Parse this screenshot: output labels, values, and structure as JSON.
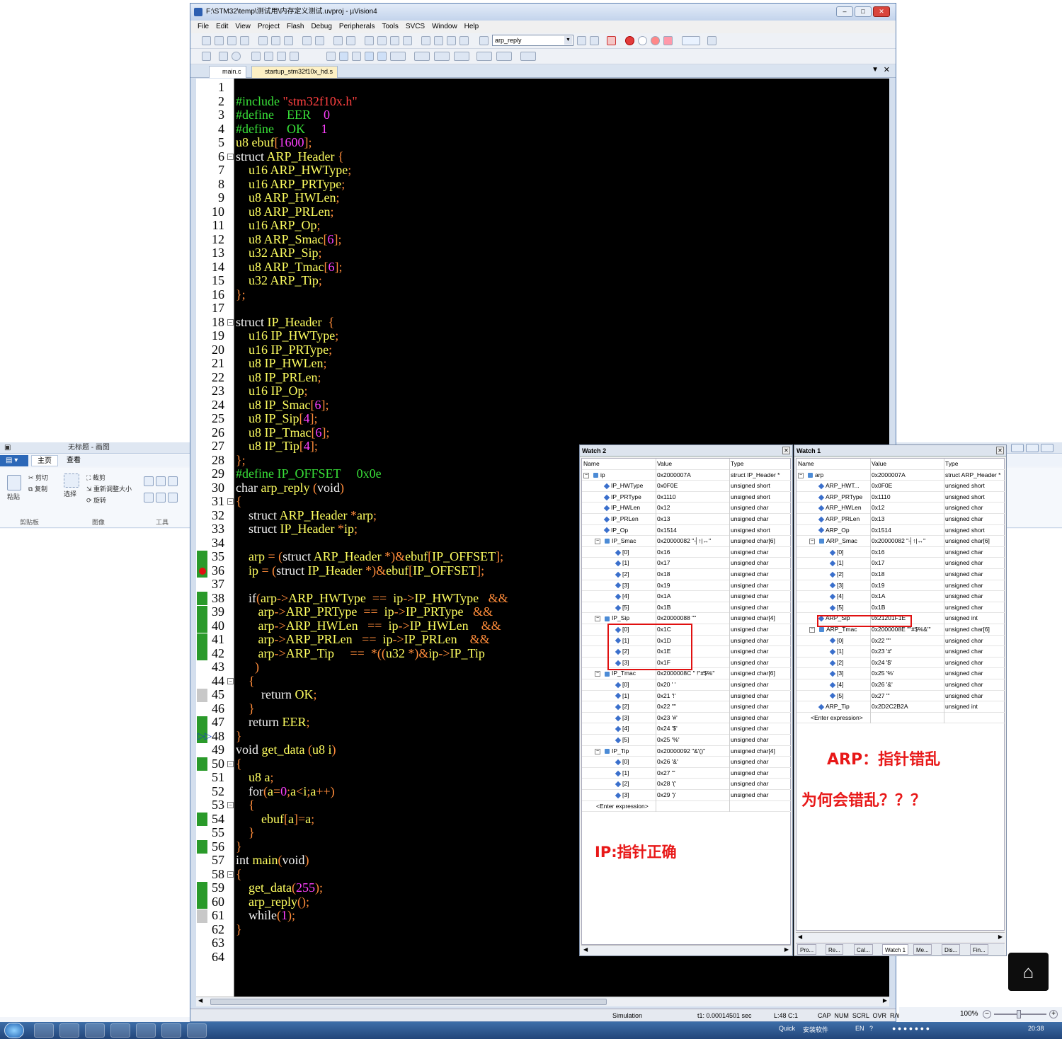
{
  "paint": {
    "title": "无标题 - 画图",
    "tabs": [
      "主页",
      "查看"
    ],
    "items": {
      "cut": "剪切",
      "copy": "复制",
      "paste": "粘贴",
      "crop": "裁剪",
      "resize": "重新调整大小",
      "rotate": "旋转",
      "select": "选择"
    },
    "groups": [
      "剪贴板",
      "图像",
      "工具"
    ],
    "zoom": "100%"
  },
  "uvision": {
    "title": "F:\\STM32\\temp\\测试用\\内存定义测试.uvproj - µVision4",
    "menu": [
      "File",
      "Edit",
      "View",
      "Project",
      "Flash",
      "Debug",
      "Peripherals",
      "Tools",
      "SVCS",
      "Window",
      "Help"
    ],
    "combo_value": "arp_reply",
    "tabs": [
      {
        "label": "main.c",
        "active": true
      },
      {
        "label": "startup_stm32f10x_hd.s",
        "active": false
      }
    ],
    "status": {
      "mode": "Simulation",
      "time": "t1: 0.00014501 sec",
      "pos": "L:48 C:1",
      "keys": "CAP  NUM  SCRL  OVR  R/W"
    }
  },
  "code_lines": [
    [],
    [
      [
        "pp",
        "#include "
      ],
      [
        "st",
        "\"stm32f10x.h\""
      ]
    ],
    [
      [
        "pp",
        "#define    EER    "
      ],
      [
        "nm",
        "0"
      ]
    ],
    [
      [
        "pp",
        "#define    OK     "
      ],
      [
        "nm",
        "1"
      ]
    ],
    [
      [
        "ty",
        "u8 ebuf"
      ],
      [
        "op",
        "["
      ],
      [
        "nm",
        "1600"
      ],
      [
        "op",
        "];"
      ]
    ],
    [
      [
        "wh",
        "struct "
      ],
      [
        "ty",
        "ARP_Header "
      ],
      [
        "op",
        "{"
      ]
    ],
    [
      [
        "ty",
        "    u16 ARP_HWType"
      ],
      [
        "op",
        ";"
      ]
    ],
    [
      [
        "ty",
        "    u16 ARP_PRType"
      ],
      [
        "op",
        ";"
      ]
    ],
    [
      [
        "ty",
        "    u8 ARP_HWLen"
      ],
      [
        "op",
        ";"
      ]
    ],
    [
      [
        "ty",
        "    u8 ARP_PRLen"
      ],
      [
        "op",
        ";"
      ]
    ],
    [
      [
        "ty",
        "    u16 ARP_Op"
      ],
      [
        "op",
        ";"
      ]
    ],
    [
      [
        "ty",
        "    u8 ARP_Smac"
      ],
      [
        "op",
        "["
      ],
      [
        "nm",
        "6"
      ],
      [
        "op",
        "];"
      ]
    ],
    [
      [
        "ty",
        "    u32 ARP_Sip"
      ],
      [
        "op",
        ";"
      ]
    ],
    [
      [
        "ty",
        "    u8 ARP_Tmac"
      ],
      [
        "op",
        "["
      ],
      [
        "nm",
        "6"
      ],
      [
        "op",
        "];"
      ]
    ],
    [
      [
        "ty",
        "    u32 ARP_Tip"
      ],
      [
        "op",
        ";"
      ]
    ],
    [
      [
        "op",
        "};"
      ]
    ],
    [],
    [
      [
        "wh",
        "struct "
      ],
      [
        "ty",
        "IP_Header  "
      ],
      [
        "op",
        "{"
      ]
    ],
    [
      [
        "ty",
        "    u16 IP_HWType"
      ],
      [
        "op",
        ";"
      ]
    ],
    [
      [
        "ty",
        "    u16 IP_PRType"
      ],
      [
        "op",
        ";"
      ]
    ],
    [
      [
        "ty",
        "    u8 IP_HWLen"
      ],
      [
        "op",
        ";"
      ]
    ],
    [
      [
        "ty",
        "    u8 IP_PRLen"
      ],
      [
        "op",
        ";"
      ]
    ],
    [
      [
        "ty",
        "    u16 IP_Op"
      ],
      [
        "op",
        ";"
      ]
    ],
    [
      [
        "ty",
        "    u8 IP_Smac"
      ],
      [
        "op",
        "["
      ],
      [
        "nm",
        "6"
      ],
      [
        "op",
        "];"
      ]
    ],
    [
      [
        "ty",
        "    u8 IP_Sip"
      ],
      [
        "op",
        "["
      ],
      [
        "nm",
        "4"
      ],
      [
        "op",
        "];"
      ]
    ],
    [
      [
        "ty",
        "    u8 IP_Tmac"
      ],
      [
        "op",
        "["
      ],
      [
        "nm",
        "6"
      ],
      [
        "op",
        "];"
      ]
    ],
    [
      [
        "ty",
        "    u8 IP_Tip"
      ],
      [
        "op",
        "["
      ],
      [
        "nm",
        "4"
      ],
      [
        "op",
        "];"
      ]
    ],
    [
      [
        "op",
        "};"
      ]
    ],
    [
      [
        "pp",
        "#define IP_OFFSET     0x0e"
      ]
    ],
    [
      [
        "wh",
        "char "
      ],
      [
        "ty",
        "arp_reply "
      ],
      [
        "op",
        "("
      ],
      [
        "wh",
        "void"
      ],
      [
        "op",
        ")"
      ]
    ],
    [
      [
        "op",
        "{"
      ]
    ],
    [
      [
        "wh",
        "    struct "
      ],
      [
        "ty",
        "ARP_Header "
      ],
      [
        "op",
        "*"
      ],
      [
        "ty",
        "arp"
      ],
      [
        "op",
        ";"
      ]
    ],
    [
      [
        "wh",
        "    struct "
      ],
      [
        "ty",
        "IP_Header "
      ],
      [
        "op",
        "*"
      ],
      [
        "ty",
        "ip"
      ],
      [
        "op",
        ";"
      ]
    ],
    [],
    [
      [
        "ty",
        "    arp "
      ],
      [
        "op",
        "= ("
      ],
      [
        "wh",
        "struct "
      ],
      [
        "ty",
        "ARP_Header "
      ],
      [
        "op",
        "*)&"
      ],
      [
        "ty",
        "ebuf"
      ],
      [
        "op",
        "["
      ],
      [
        "ty",
        "IP_OFFSET"
      ],
      [
        "op",
        "];"
      ]
    ],
    [
      [
        "ty",
        "    ip "
      ],
      [
        "op",
        "= ("
      ],
      [
        "wh",
        "struct "
      ],
      [
        "ty",
        "IP_Header "
      ],
      [
        "op",
        "*)&"
      ],
      [
        "ty",
        "ebuf"
      ],
      [
        "op",
        "["
      ],
      [
        "ty",
        "IP_OFFSET"
      ],
      [
        "op",
        "];"
      ]
    ],
    [],
    [
      [
        "wh",
        "    if"
      ],
      [
        "op",
        "("
      ],
      [
        "ty",
        "arp"
      ],
      [
        "op",
        "->"
      ],
      [
        "ty",
        "ARP_HWType  "
      ],
      [
        "op",
        "==  "
      ],
      [
        "ty",
        "ip"
      ],
      [
        "op",
        "->"
      ],
      [
        "ty",
        "IP_HWType   "
      ],
      [
        "op",
        "&&"
      ]
    ],
    [
      [
        "ty",
        "       arp"
      ],
      [
        "op",
        "->"
      ],
      [
        "ty",
        "ARP_PRType  "
      ],
      [
        "op",
        "==  "
      ],
      [
        "ty",
        "ip"
      ],
      [
        "op",
        "->"
      ],
      [
        "ty",
        "IP_PRType   "
      ],
      [
        "op",
        "&&"
      ]
    ],
    [
      [
        "ty",
        "       arp"
      ],
      [
        "op",
        "->"
      ],
      [
        "ty",
        "ARP_HWLen   "
      ],
      [
        "op",
        "==  "
      ],
      [
        "ty",
        "ip"
      ],
      [
        "op",
        "->"
      ],
      [
        "ty",
        "IP_HWLen    "
      ],
      [
        "op",
        "&&"
      ]
    ],
    [
      [
        "ty",
        "       arp"
      ],
      [
        "op",
        "->"
      ],
      [
        "ty",
        "ARP_PRLen   "
      ],
      [
        "op",
        "==  "
      ],
      [
        "ty",
        "ip"
      ],
      [
        "op",
        "->"
      ],
      [
        "ty",
        "IP_PRLen    "
      ],
      [
        "op",
        "&&"
      ]
    ],
    [
      [
        "ty",
        "       arp"
      ],
      [
        "op",
        "->"
      ],
      [
        "ty",
        "ARP_Tip     "
      ],
      [
        "op",
        "==  *(("
      ],
      [
        "ty",
        "u32 "
      ],
      [
        "op",
        "*)&"
      ],
      [
        "ty",
        "ip"
      ],
      [
        "op",
        "->"
      ],
      [
        "ty",
        "IP_Tip"
      ]
    ],
    [
      [
        "op",
        "      )"
      ]
    ],
    [
      [
        "op",
        "    {"
      ]
    ],
    [
      [
        "wh",
        "        return "
      ],
      [
        "ty",
        "OK"
      ],
      [
        "op",
        ";"
      ]
    ],
    [
      [
        "op",
        "    }"
      ]
    ],
    [
      [
        "wh",
        "    return "
      ],
      [
        "ty",
        "EER"
      ],
      [
        "op",
        ";"
      ]
    ],
    [
      [
        "op",
        "}"
      ]
    ],
    [
      [
        "wh",
        "void "
      ],
      [
        "ty",
        "get_data "
      ],
      [
        "op",
        "("
      ],
      [
        "ty",
        "u8 i"
      ],
      [
        "op",
        ")"
      ]
    ],
    [
      [
        "op",
        "{"
      ]
    ],
    [
      [
        "ty",
        "    u8 a"
      ],
      [
        "op",
        ";"
      ]
    ],
    [
      [
        "wh",
        "    for"
      ],
      [
        "op",
        "("
      ],
      [
        "ty",
        "a"
      ],
      [
        "op",
        "="
      ],
      [
        "nm",
        "0"
      ],
      [
        "op",
        ";"
      ],
      [
        "ty",
        "a"
      ],
      [
        "op",
        "<"
      ],
      [
        "ty",
        "i"
      ],
      [
        "op",
        ";"
      ],
      [
        "ty",
        "a"
      ],
      [
        "op",
        "++)"
      ]
    ],
    [
      [
        "op",
        "    {"
      ]
    ],
    [
      [
        "ty",
        "        ebuf"
      ],
      [
        "op",
        "["
      ],
      [
        "ty",
        "a"
      ],
      [
        "op",
        "]="
      ],
      [
        "ty",
        "a"
      ],
      [
        "op",
        ";"
      ]
    ],
    [
      [
        "op",
        "    }"
      ]
    ],
    [
      [
        "op",
        "}"
      ]
    ],
    [
      [
        "wh",
        "int "
      ],
      [
        "ty",
        "main"
      ],
      [
        "op",
        "("
      ],
      [
        "wh",
        "void"
      ],
      [
        "op",
        ")"
      ]
    ],
    [
      [
        "op",
        "{"
      ]
    ],
    [
      [
        "ty",
        "    get_data"
      ],
      [
        "op",
        "("
      ],
      [
        "nm",
        "255"
      ],
      [
        "op",
        ");"
      ]
    ],
    [
      [
        "ty",
        "    arp_reply"
      ],
      [
        "op",
        "();"
      ]
    ],
    [
      [
        "wh",
        "    while"
      ],
      [
        "op",
        "("
      ],
      [
        "nm",
        "1"
      ],
      [
        "op",
        ");"
      ]
    ],
    [
      [
        "op",
        "}"
      ]
    ],
    [],
    []
  ],
  "gutter_marks": {
    "green": [
      35,
      36,
      38,
      39,
      40,
      41,
      42,
      47,
      48,
      50,
      54,
      56,
      59,
      60
    ],
    "gray": [
      45,
      61
    ],
    "breakpoint": [
      36
    ],
    "current": [
      48
    ],
    "folds": [
      6,
      18,
      31,
      44,
      50,
      53,
      58
    ]
  },
  "watch2": {
    "title": "Watch 2",
    "headers": [
      "Name",
      "Value",
      "Type"
    ],
    "rows": [
      {
        "d": 0,
        "t": "-",
        "name": "ip",
        "value": "0x2000007A",
        "type": "struct IP_Header *"
      },
      {
        "d": 1,
        "t": "",
        "name": "IP_HWType",
        "value": "0x0F0E",
        "type": "unsigned short"
      },
      {
        "d": 1,
        "t": "",
        "name": "IP_PRType",
        "value": "0x1110",
        "type": "unsigned short"
      },
      {
        "d": 1,
        "t": "",
        "name": "IP_HWLen",
        "value": "0x12",
        "type": "unsigned char"
      },
      {
        "d": 1,
        "t": "",
        "name": "IP_PRLen",
        "value": "0x13",
        "type": "unsigned char"
      },
      {
        "d": 1,
        "t": "",
        "name": "IP_Op",
        "value": "0x1514",
        "type": "unsigned short"
      },
      {
        "d": 1,
        "t": "-",
        "name": "IP_Smac",
        "value": "0x20000082 \"┤↑|↔\"",
        "type": "unsigned char[6]"
      },
      {
        "d": 2,
        "t": "",
        "name": "[0]",
        "value": "0x16",
        "type": "unsigned char"
      },
      {
        "d": 2,
        "t": "",
        "name": "[1]",
        "value": "0x17",
        "type": "unsigned char"
      },
      {
        "d": 2,
        "t": "",
        "name": "[2]",
        "value": "0x18",
        "type": "unsigned char"
      },
      {
        "d": 2,
        "t": "",
        "name": "[3]",
        "value": "0x19",
        "type": "unsigned char"
      },
      {
        "d": 2,
        "t": "",
        "name": "[4]",
        "value": "0x1A",
        "type": "unsigned char"
      },
      {
        "d": 2,
        "t": "",
        "name": "[5]",
        "value": "0x1B",
        "type": "unsigned char"
      },
      {
        "d": 1,
        "t": "-",
        "name": "IP_Sip",
        "value": "0x20000088 \"\"",
        "type": "unsigned char[4]"
      },
      {
        "d": 2,
        "t": "",
        "name": "[0]",
        "value": "0x1C",
        "type": "unsigned char"
      },
      {
        "d": 2,
        "t": "",
        "name": "[1]",
        "value": "0x1D",
        "type": "unsigned char"
      },
      {
        "d": 2,
        "t": "",
        "name": "[2]",
        "value": "0x1E",
        "type": "unsigned char"
      },
      {
        "d": 2,
        "t": "",
        "name": "[3]",
        "value": "0x1F",
        "type": "unsigned char"
      },
      {
        "d": 1,
        "t": "-",
        "name": "IP_Tmac",
        "value": "0x2000008C \" !\"#$%\"",
        "type": "unsigned char[6]"
      },
      {
        "d": 2,
        "t": "",
        "name": "[0]",
        "value": "0x20 ' '",
        "type": "unsigned char"
      },
      {
        "d": 2,
        "t": "",
        "name": "[1]",
        "value": "0x21 '!'",
        "type": "unsigned char"
      },
      {
        "d": 2,
        "t": "",
        "name": "[2]",
        "value": "0x22 '\"'",
        "type": "unsigned char"
      },
      {
        "d": 2,
        "t": "",
        "name": "[3]",
        "value": "0x23 '#'",
        "type": "unsigned char"
      },
      {
        "d": 2,
        "t": "",
        "name": "[4]",
        "value": "0x24 '$'",
        "type": "unsigned char"
      },
      {
        "d": 2,
        "t": "",
        "name": "[5]",
        "value": "0x25 '%'",
        "type": "unsigned char"
      },
      {
        "d": 1,
        "t": "-",
        "name": "IP_Tip",
        "value": "0x20000092 \"&'()\"",
        "type": "unsigned char[4]"
      },
      {
        "d": 2,
        "t": "",
        "name": "[0]",
        "value": "0x26 '&'",
        "type": "unsigned char"
      },
      {
        "d": 2,
        "t": "",
        "name": "[1]",
        "value": "0x27 '''",
        "type": "unsigned char"
      },
      {
        "d": 2,
        "t": "",
        "name": "[2]",
        "value": "0x28 '('",
        "type": "unsigned char"
      },
      {
        "d": 2,
        "t": "",
        "name": "[3]",
        "value": "0x29 ')'",
        "type": "unsigned char"
      }
    ],
    "enter": "<Enter expression>"
  },
  "watch1": {
    "title": "Watch 1",
    "headers": [
      "Name",
      "Value",
      "Type"
    ],
    "rows": [
      {
        "d": 0,
        "t": "-",
        "name": "arp",
        "value": "0x2000007A",
        "type": "struct ARP_Header *"
      },
      {
        "d": 1,
        "t": "",
        "name": "ARP_HWT...",
        "value": "0x0F0E",
        "type": "unsigned short"
      },
      {
        "d": 1,
        "t": "",
        "name": "ARP_PRType",
        "value": "0x1110",
        "type": "unsigned short"
      },
      {
        "d": 1,
        "t": "",
        "name": "ARP_HWLen",
        "value": "0x12",
        "type": "unsigned char"
      },
      {
        "d": 1,
        "t": "",
        "name": "ARP_PRLen",
        "value": "0x13",
        "type": "unsigned char"
      },
      {
        "d": 1,
        "t": "",
        "name": "ARP_Op",
        "value": "0x1514",
        "type": "unsigned short"
      },
      {
        "d": 1,
        "t": "-",
        "name": "ARP_Smac",
        "value": "0x20000082 \"┤↑|↔\"",
        "type": "unsigned char[6]"
      },
      {
        "d": 2,
        "t": "",
        "name": "[0]",
        "value": "0x16",
        "type": "unsigned char"
      },
      {
        "d": 2,
        "t": "",
        "name": "[1]",
        "value": "0x17",
        "type": "unsigned char"
      },
      {
        "d": 2,
        "t": "",
        "name": "[2]",
        "value": "0x18",
        "type": "unsigned char"
      },
      {
        "d": 2,
        "t": "",
        "name": "[3]",
        "value": "0x19",
        "type": "unsigned char"
      },
      {
        "d": 2,
        "t": "",
        "name": "[4]",
        "value": "0x1A",
        "type": "unsigned char"
      },
      {
        "d": 2,
        "t": "",
        "name": "[5]",
        "value": "0x1B",
        "type": "unsigned char"
      },
      {
        "d": 1,
        "t": "",
        "name": "ARP_Sip",
        "value": "0x21201F1E",
        "type": "unsigned int"
      },
      {
        "d": 1,
        "t": "-",
        "name": "ARP_Tmac",
        "value": "0x2000008E \"\"#$%&'\"",
        "type": "unsigned char[6]"
      },
      {
        "d": 2,
        "t": "",
        "name": "[0]",
        "value": "0x22 '\"'",
        "type": "unsigned char"
      },
      {
        "d": 2,
        "t": "",
        "name": "[1]",
        "value": "0x23 '#'",
        "type": "unsigned char"
      },
      {
        "d": 2,
        "t": "",
        "name": "[2]",
        "value": "0x24 '$'",
        "type": "unsigned char"
      },
      {
        "d": 2,
        "t": "",
        "name": "[3]",
        "value": "0x25 '%'",
        "type": "unsigned char"
      },
      {
        "d": 2,
        "t": "",
        "name": "[4]",
        "value": "0x26 '&'",
        "type": "unsigned char"
      },
      {
        "d": 2,
        "t": "",
        "name": "[5]",
        "value": "0x27 '''",
        "type": "unsigned char"
      },
      {
        "d": 1,
        "t": "",
        "name": "ARP_Tip",
        "value": "0x2D2C2B2A",
        "type": "unsigned int"
      }
    ],
    "enter": "<Enter expression>",
    "bottom_tabs": [
      "Pro...",
      "Re...",
      "Cal...",
      "Watch 1",
      "Me...",
      "Dis...",
      "Fin..."
    ]
  },
  "annotations": {
    "arp": "ARP：指针错乱",
    "why": "为何会错乱？？？",
    "ip": "IP:指针正确"
  },
  "taskbar": {
    "quick": "Quick",
    "software": "安装软件",
    "lang": "EN",
    "clock": "20:38"
  },
  "colors": {
    "editor_bg": "#000000",
    "annotation": "#e81818",
    "gutter_green": "#2a9a2a"
  }
}
